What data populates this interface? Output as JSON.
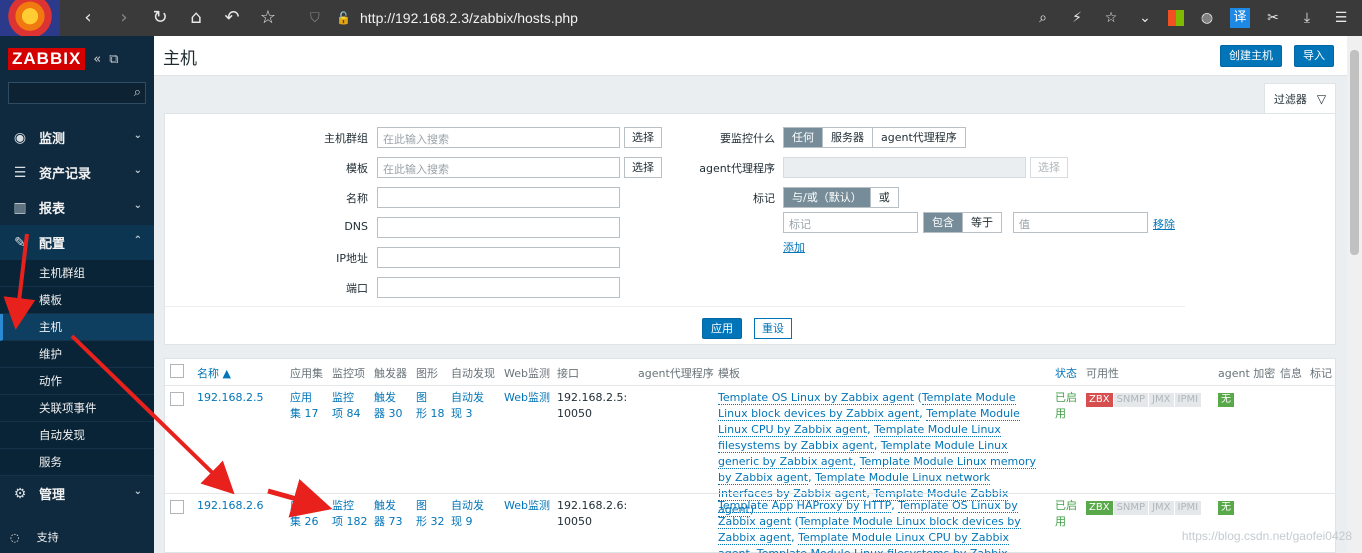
{
  "browser": {
    "url": "http://192.168.2.3/zabbix/hosts.php",
    "translate_label": "译"
  },
  "sidebar": {
    "logo": "ZABBIX",
    "menu": [
      {
        "label": "监测",
        "icon": "eye-icon"
      },
      {
        "label": "资产记录",
        "icon": "list-icon"
      },
      {
        "label": "报表",
        "icon": "chart-icon"
      },
      {
        "label": "配置",
        "icon": "wrench-icon"
      },
      {
        "label": "管理",
        "icon": "gear-icon"
      }
    ],
    "submenu": [
      "主机群组",
      "模板",
      "主机",
      "维护",
      "动作",
      "关联项事件",
      "自动发现",
      "服务"
    ],
    "support": "支持"
  },
  "header": {
    "title": "主机",
    "create_button": "创建主机",
    "import_button": "导入"
  },
  "filter": {
    "tab_label": "过滤器",
    "host_group_label": "主机群组",
    "host_group_placeholder": "在此输入搜索",
    "template_label": "模板",
    "template_placeholder": "在此输入搜索",
    "select_label": "选择",
    "name_label": "名称",
    "dns_label": "DNS",
    "ip_label": "IP地址",
    "port_label": "端口",
    "monitored_by_label": "要监控什么",
    "monitored_by_options": [
      "任何",
      "服务器",
      "agent代理程序"
    ],
    "proxy_label": "agent代理程序",
    "proxy_select": "选择",
    "tags_label": "标记",
    "tags_mode_options": [
      "与/或（默认）",
      "或"
    ],
    "tag_placeholder": "标记",
    "tag_operator_options": [
      "包含",
      "等于"
    ],
    "value_placeholder": "值",
    "remove_link": "移除",
    "add_link": "添加",
    "apply_button": "应用",
    "reset_button": "重设"
  },
  "table": {
    "headers": {
      "name": "名称 ▲",
      "applications": "应用集",
      "items": "监控项",
      "triggers": "触发器",
      "graphs": "图形",
      "discovery": "自动发现",
      "web": "Web监测",
      "interface": "接口",
      "proxy": "agent代理程序",
      "templates": "模板",
      "status": "状态",
      "availability": "可用性",
      "encryption": "agent 加密",
      "info": "信息",
      "tags": "标记"
    },
    "rows": [
      {
        "name": "192.168.2.5",
        "app_a": "应用",
        "app_b": "集 17",
        "items_a": "监控",
        "items_b": "项 84",
        "trig_a": "触发",
        "trig_b": "器 30",
        "graph_a": "图",
        "graph_b": "形 18",
        "disc_a": "自动发",
        "disc_b": "现 3",
        "web": "Web监测",
        "iface_a": "192.168.2.5:",
        "iface_b": "10050",
        "templates": [
          "Template OS Linux by Zabbix agent",
          " (",
          "Template Module Linux block devices by Zabbix agent",
          ", ",
          "Template Module Linux CPU by Zabbix agent",
          ", ",
          "Template Module Linux filesystems by Zabbix agent",
          ", ",
          "Template Module Linux generic by Zabbix agent",
          ", ",
          "Template Module Linux memory by Zabbix agent",
          ", ",
          "Template Module Linux network interfaces by Zabbix agent",
          ", ",
          "Template Module Zabbix agent",
          ")"
        ],
        "status_a": "已启",
        "status_b": "用",
        "avail": [
          "ZBX",
          "SNMP",
          "JMX",
          "IPMI"
        ],
        "encryption": "无"
      },
      {
        "name": "192.168.2.6",
        "app_a": "应用",
        "app_b": "集 26",
        "items_a": "监控",
        "items_b": "项 182",
        "trig_a": "触发",
        "trig_b": "器 73",
        "graph_a": "图",
        "graph_b": "形 32",
        "disc_a": "自动发",
        "disc_b": "现 9",
        "web": "Web监测",
        "iface_a": "192.168.2.6:",
        "iface_b": "10050",
        "templates": [
          "Template App HAProxy by HTTP",
          ", ",
          "Template OS Linux by Zabbix agent",
          " (",
          "Template Module Linux block devices by Zabbix agent",
          ", ",
          "Template Module Linux CPU by Zabbix agent",
          ", ",
          "Template Module Linux filesystems by Zabbix agent",
          ", ",
          "Template Module Linux generic"
        ],
        "status_a": "已启",
        "status_b": "用",
        "avail": [
          "ZBX",
          "SNMP",
          "JMX",
          "IPMI"
        ],
        "encryption": "无"
      }
    ]
  },
  "watermark": "https://blog.csdn.net/gaofei0428",
  "colors": {
    "accent": "#0275b8",
    "sidebar": "#0f2a3f",
    "zbx_red": "#d64e4e",
    "zbx_green": "#59a849",
    "arrow": "#e8211c"
  }
}
